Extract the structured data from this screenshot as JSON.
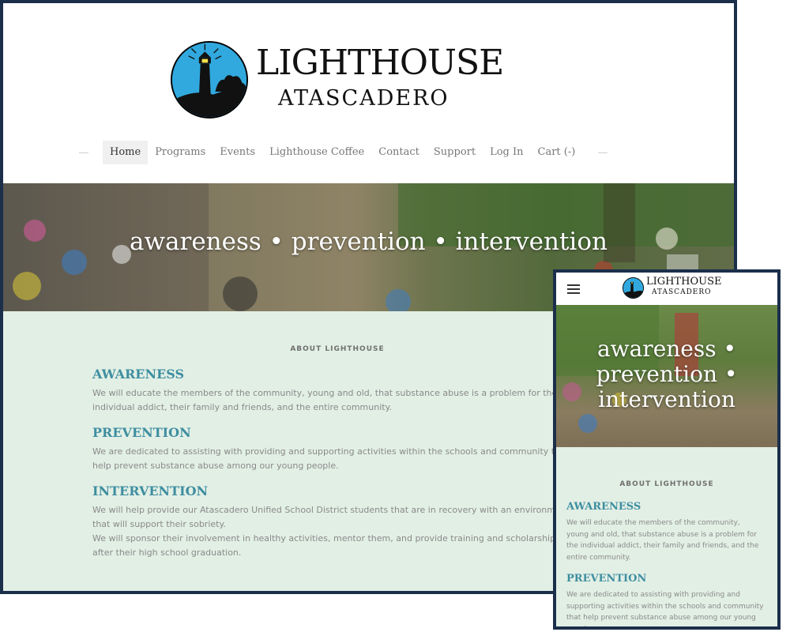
{
  "brand": {
    "title": "LIGHTHOUSE",
    "subtitle": "ATASCADERO",
    "logo_text": "Lighthouse"
  },
  "nav": {
    "items": [
      {
        "label": "Home",
        "active": true
      },
      {
        "label": "Programs"
      },
      {
        "label": "Events"
      },
      {
        "label": "Lighthouse Coffee"
      },
      {
        "label": "Contact"
      },
      {
        "label": "Support"
      },
      {
        "label": "Log In"
      },
      {
        "label": "Cart (-)"
      }
    ]
  },
  "hero": {
    "tagline": "awareness • prevention • intervention"
  },
  "about": {
    "label": "ABOUT LIGHTHOUSE",
    "sections": [
      {
        "heading": "AWARENESS",
        "text": "We will educate the members of the community, young and old, that substance abuse is a problem for the individual addict, their family and friends, and the entire community."
      },
      {
        "heading": "PREVENTION",
        "text": "We are dedicated to assisting with providing and supporting activities within the schools and community that help prevent substance abuse among our young people."
      },
      {
        "heading": "INTERVENTION",
        "text": "We will help provide our Atascadero Unified School District students that are in recovery with an environment that will support their sobriety.",
        "text2": "We will sponsor their involvement in healthy activities, mentor them, and provide training and scholarships after their high school graduation."
      }
    ]
  },
  "mobile": {
    "hero_lines": [
      "awareness •",
      "prevention •",
      "intervention"
    ]
  },
  "colors": {
    "frame": "#1b2f4b",
    "heading": "#3e8ea0",
    "section_bg": "#e2efe5",
    "logo_blue": "#31a9de"
  }
}
